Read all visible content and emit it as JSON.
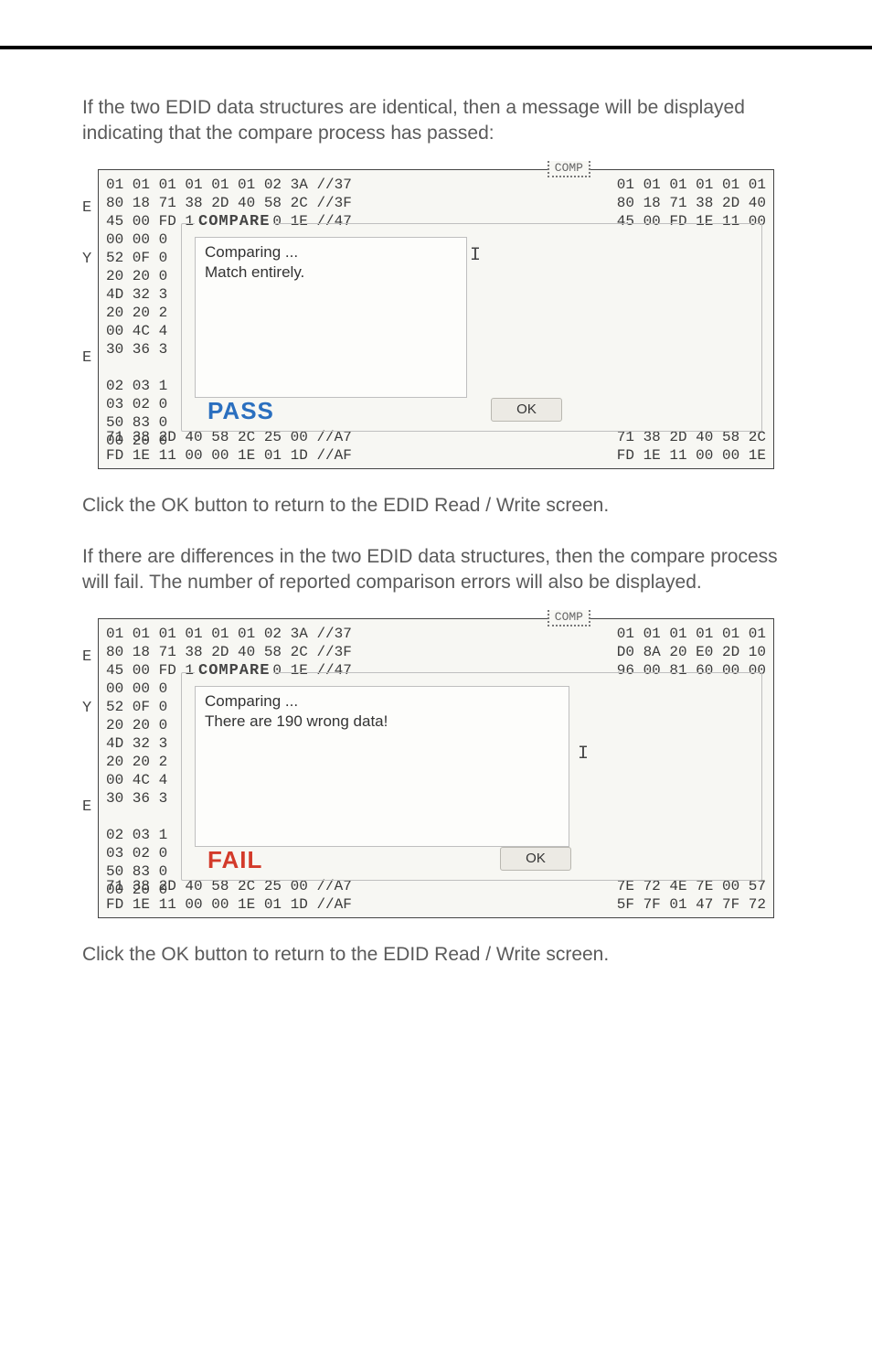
{
  "paragraphs": {
    "intro_pass": "If the two EDID data structures are identical, then a message will be displayed indicating that the compare process has passed:",
    "after_pass": "Click the OK button to return to the EDID Read / Write screen.",
    "intro_fail": "If there are differences in the two EDID data structures, then the compare process will fail.  The number of reported comparison errors will also be displayed.",
    "after_fail": "Click the OK button to return to the EDID Read / Write screen."
  },
  "figure_common": {
    "stub_label": "COMP",
    "compare_legend": "COMPARE",
    "ok_label": "OK",
    "side_letters": [
      "E",
      "Y",
      "E"
    ],
    "caret_glyph": "I",
    "hex_left_top": "01 01 01 01 01 01 02 3A //37\n80 18 71 38 2D 40 58 2C //3F\n45 00 FD 1E 11 00 00 1E //47\n00 00 0\n52 0F 0\n20 20 0\n4D 32 3\n20 20 2\n00 4C 4\n30 36 3\n\n02 03 1\n03 02 0\n50 83 0\n00 20 0",
    "hex_left_bottom": "71 38 2D 40 58 2C 25 00 //A7\nFD 1E 11 00 00 1E 01 1D //AF"
  },
  "figure_pass": {
    "comparing_line": "Comparing ...",
    "result_line": "Match entirely.",
    "result_word": "PASS",
    "hex_right_top": "01 01 01 01 01 01\n80 18 71 38 2D 40\n45 00 FD 1E 11 00",
    "hex_right_bottom": "71 38 2D 40 58 2C\nFD 1E 11 00 00 1E"
  },
  "figure_fail": {
    "comparing_line": "Comparing ...",
    "result_line": "There are 190 wrong data!",
    "result_word": "FAIL",
    "hex_right_top": "01 01 01 01 01 01\nD0 8A 20 E0 2D 10\n96 00 81 60 00 00",
    "hex_right_bottom": "7E 72 4E 7E 00 57\n5F 7F 01 47 7F 72"
  }
}
